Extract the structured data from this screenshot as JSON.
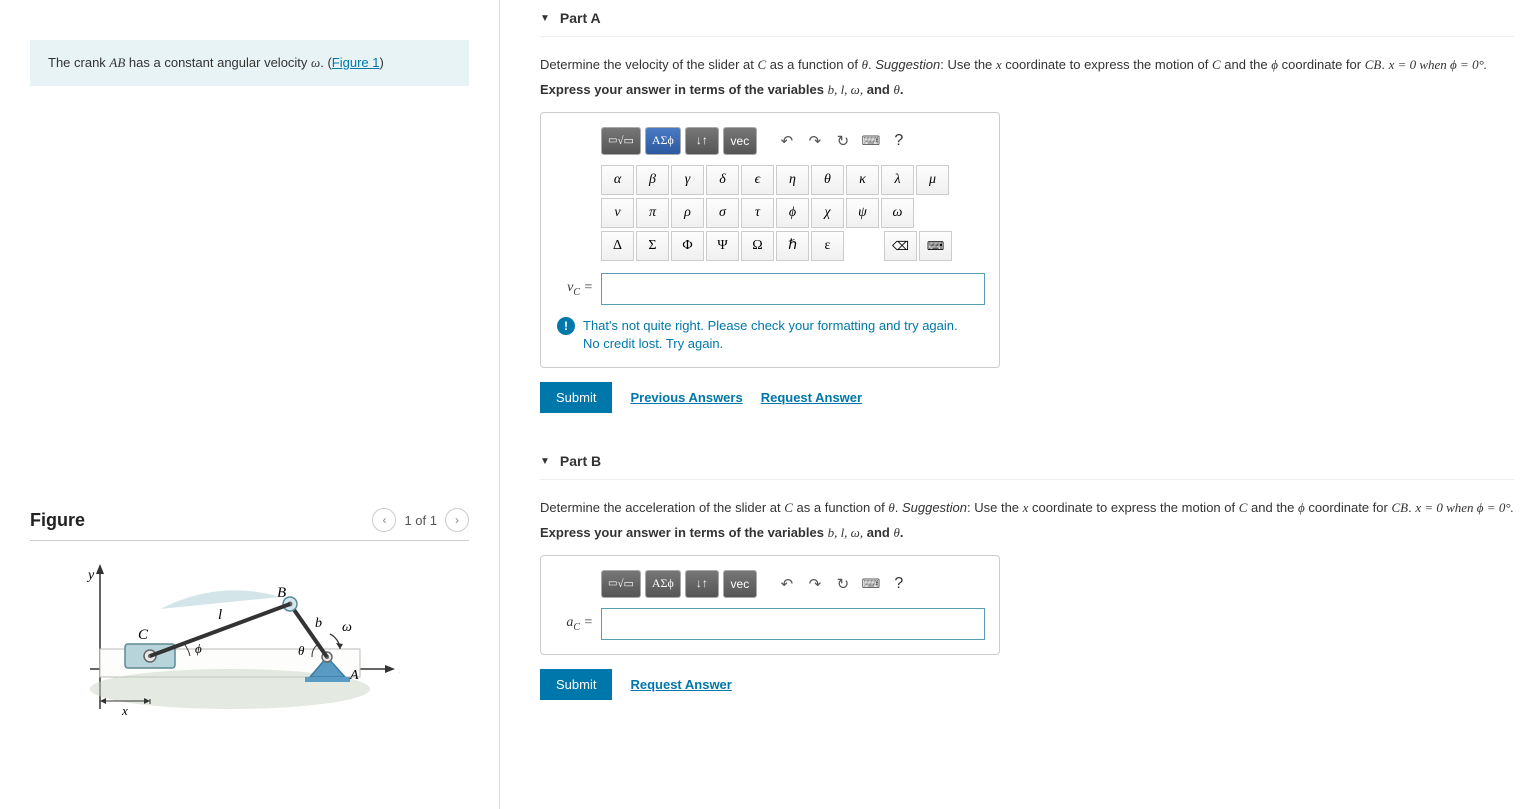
{
  "problem": {
    "prefix": "The crank ",
    "var1": "AB",
    "mid": " has a constant angular velocity ",
    "var2": "ω",
    "suffix": ". (",
    "figlink": "Figure 1",
    "close": ")"
  },
  "figure": {
    "title": "Figure",
    "pager": "1 of 1",
    "labels": {
      "C": "C",
      "B": "B",
      "A": "A",
      "l": "l",
      "b": "b",
      "omega": "ω",
      "theta": "θ",
      "phi": "ϕ",
      "x": "x",
      "xaxis": "x",
      "y": "y"
    }
  },
  "greek": {
    "row1": [
      "α",
      "β",
      "γ",
      "δ",
      "ϵ",
      "η",
      "θ",
      "κ",
      "λ",
      "μ"
    ],
    "row2": [
      "ν",
      "π",
      "ρ",
      "σ",
      "τ",
      "ϕ",
      "χ",
      "ψ",
      "ω"
    ],
    "row3": [
      "Δ",
      "Σ",
      "Φ",
      "Ψ",
      "Ω",
      "ℏ",
      "ε"
    ]
  },
  "toolbar": {
    "templates_icon": "▭√▭",
    "greek": "ΑΣϕ",
    "subscript": "↓↑",
    "vec": "vec",
    "undo": "↶",
    "redo": "↷",
    "reset": "↻",
    "keyboard": "⌨",
    "help": "?",
    "backspace": "⌫",
    "kbd2": "⌨"
  },
  "partA": {
    "title": "Part A",
    "q1": "Determine the velocity of the slider at ",
    "qC": "C",
    "q2": " as a function of ",
    "qth": "θ",
    "q3": ". ",
    "sugg_lbl": "Suggestion",
    "sugg": ": Use the ",
    "qx": "x",
    "q4": " coordinate to express the motion of ",
    "q5": " and the ",
    "qphi": "ϕ",
    "q6": " coordinate for ",
    "qCB": "CB",
    "q7": ". ",
    "cond": "x = 0 when ϕ = 0°.",
    "instruct_pre": "Express your answer in terms of the variables ",
    "instruct_vars": "b, l, ω,",
    "instruct_and": " and ",
    "instruct_last": "θ",
    "instruct_end": ".",
    "label_v": "v",
    "label_sub": "C",
    "label_eq": " =",
    "feedback1": "That's not quite right. Please check your formatting and try again.",
    "feedback2": "No credit lost. Try again.",
    "submit": "Submit",
    "prev": "Previous Answers",
    "req": "Request Answer"
  },
  "partB": {
    "title": "Part B",
    "q1": "Determine the acceleration of the slider at ",
    "label_a": "a",
    "label_sub": "C",
    "label_eq": " =",
    "submit": "Submit",
    "req": "Request Answer"
  }
}
